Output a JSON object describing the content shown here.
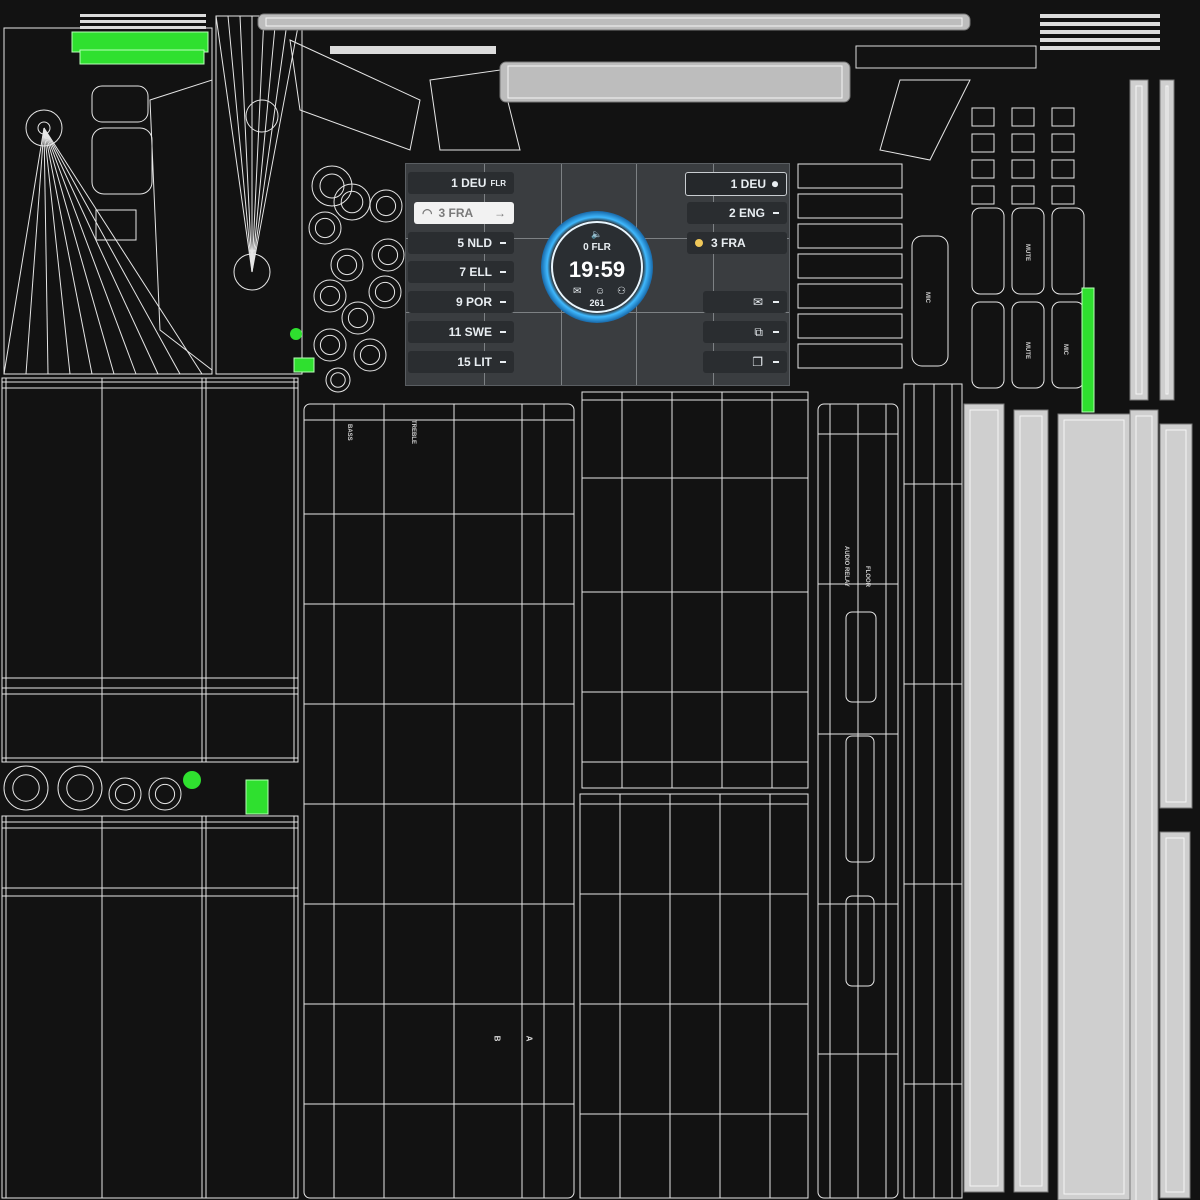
{
  "colors": {
    "background": "#121212",
    "wire": "#e6e6e6",
    "highlight": "#2fe02f",
    "screen_bg": "#3a3d40",
    "ring_glow": "#3fb9ff"
  },
  "display": {
    "left_languages": [
      {
        "label": "1 DEU",
        "tag": "FLR"
      },
      {
        "label": "3 FRA",
        "tag": ""
      },
      {
        "label": "5 NLD",
        "tag": ""
      },
      {
        "label": "7 ELL",
        "tag": ""
      },
      {
        "label": "9 POR",
        "tag": ""
      },
      {
        "label": "11 SWE",
        "tag": ""
      },
      {
        "label": "15 LIT",
        "tag": ""
      }
    ],
    "right_languages": [
      {
        "label": "1 DEU"
      },
      {
        "label": "2 ENG"
      },
      {
        "label": "3 FRA"
      }
    ],
    "floor": "0 FLR",
    "time": "19:59",
    "count": "261",
    "icons": {
      "volume": "speaker-icon",
      "mail": "mail-icon",
      "user": "user-icon",
      "mic": "mic-icon",
      "share": "share-icon",
      "copy": "copy-icon"
    }
  },
  "labels": {
    "bass": "BASS",
    "treble": "TREBLE",
    "mic": "MIC",
    "mute": "MUTE",
    "audio_relay": "AUDIO RELAY",
    "floor": "FLOOR",
    "a": "A",
    "b": "B"
  }
}
